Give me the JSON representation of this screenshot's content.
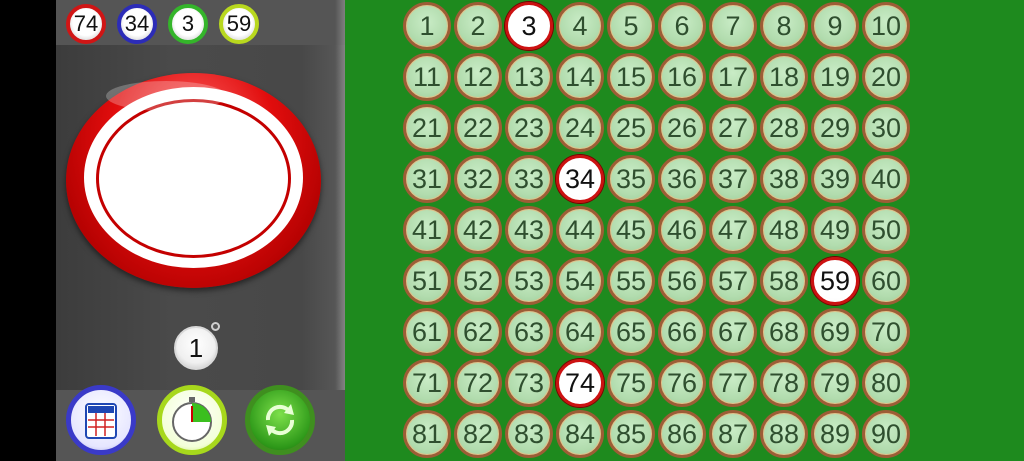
{
  "recent_balls": [
    {
      "number": "74",
      "color": "#d01515"
    },
    {
      "number": "34",
      "color": "#2c2cb8"
    },
    {
      "number": "3",
      "color": "#34b52a"
    },
    {
      "number": "59",
      "color": "#b8d81e"
    }
  ],
  "current_ball": {
    "number": "",
    "color": "#e10d0d"
  },
  "called_count": "1",
  "toolbar": [
    {
      "name": "cards-button",
      "icon": "bingo-card-icon"
    },
    {
      "name": "timer-button",
      "icon": "stopwatch-icon"
    },
    {
      "name": "reset-button",
      "icon": "refresh-icon"
    }
  ],
  "board": {
    "numbers": [
      "1",
      "2",
      "3",
      "4",
      "5",
      "6",
      "7",
      "8",
      "9",
      "10",
      "11",
      "12",
      "13",
      "14",
      "15",
      "16",
      "17",
      "18",
      "19",
      "20",
      "21",
      "22",
      "23",
      "24",
      "25",
      "26",
      "27",
      "28",
      "29",
      "30",
      "31",
      "32",
      "33",
      "34",
      "35",
      "36",
      "37",
      "38",
      "39",
      "40",
      "41",
      "42",
      "43",
      "44",
      "45",
      "46",
      "47",
      "48",
      "49",
      "50",
      "51",
      "52",
      "53",
      "54",
      "55",
      "56",
      "57",
      "58",
      "59",
      "60",
      "61",
      "62",
      "63",
      "64",
      "65",
      "66",
      "67",
      "68",
      "69",
      "70",
      "71",
      "72",
      "73",
      "74",
      "75",
      "76",
      "77",
      "78",
      "79",
      "80",
      "81",
      "82",
      "83",
      "84",
      "85",
      "86",
      "87",
      "88",
      "89",
      "90"
    ],
    "called": [
      "3",
      "34",
      "59",
      "74"
    ],
    "background": "#1e8a1e"
  }
}
